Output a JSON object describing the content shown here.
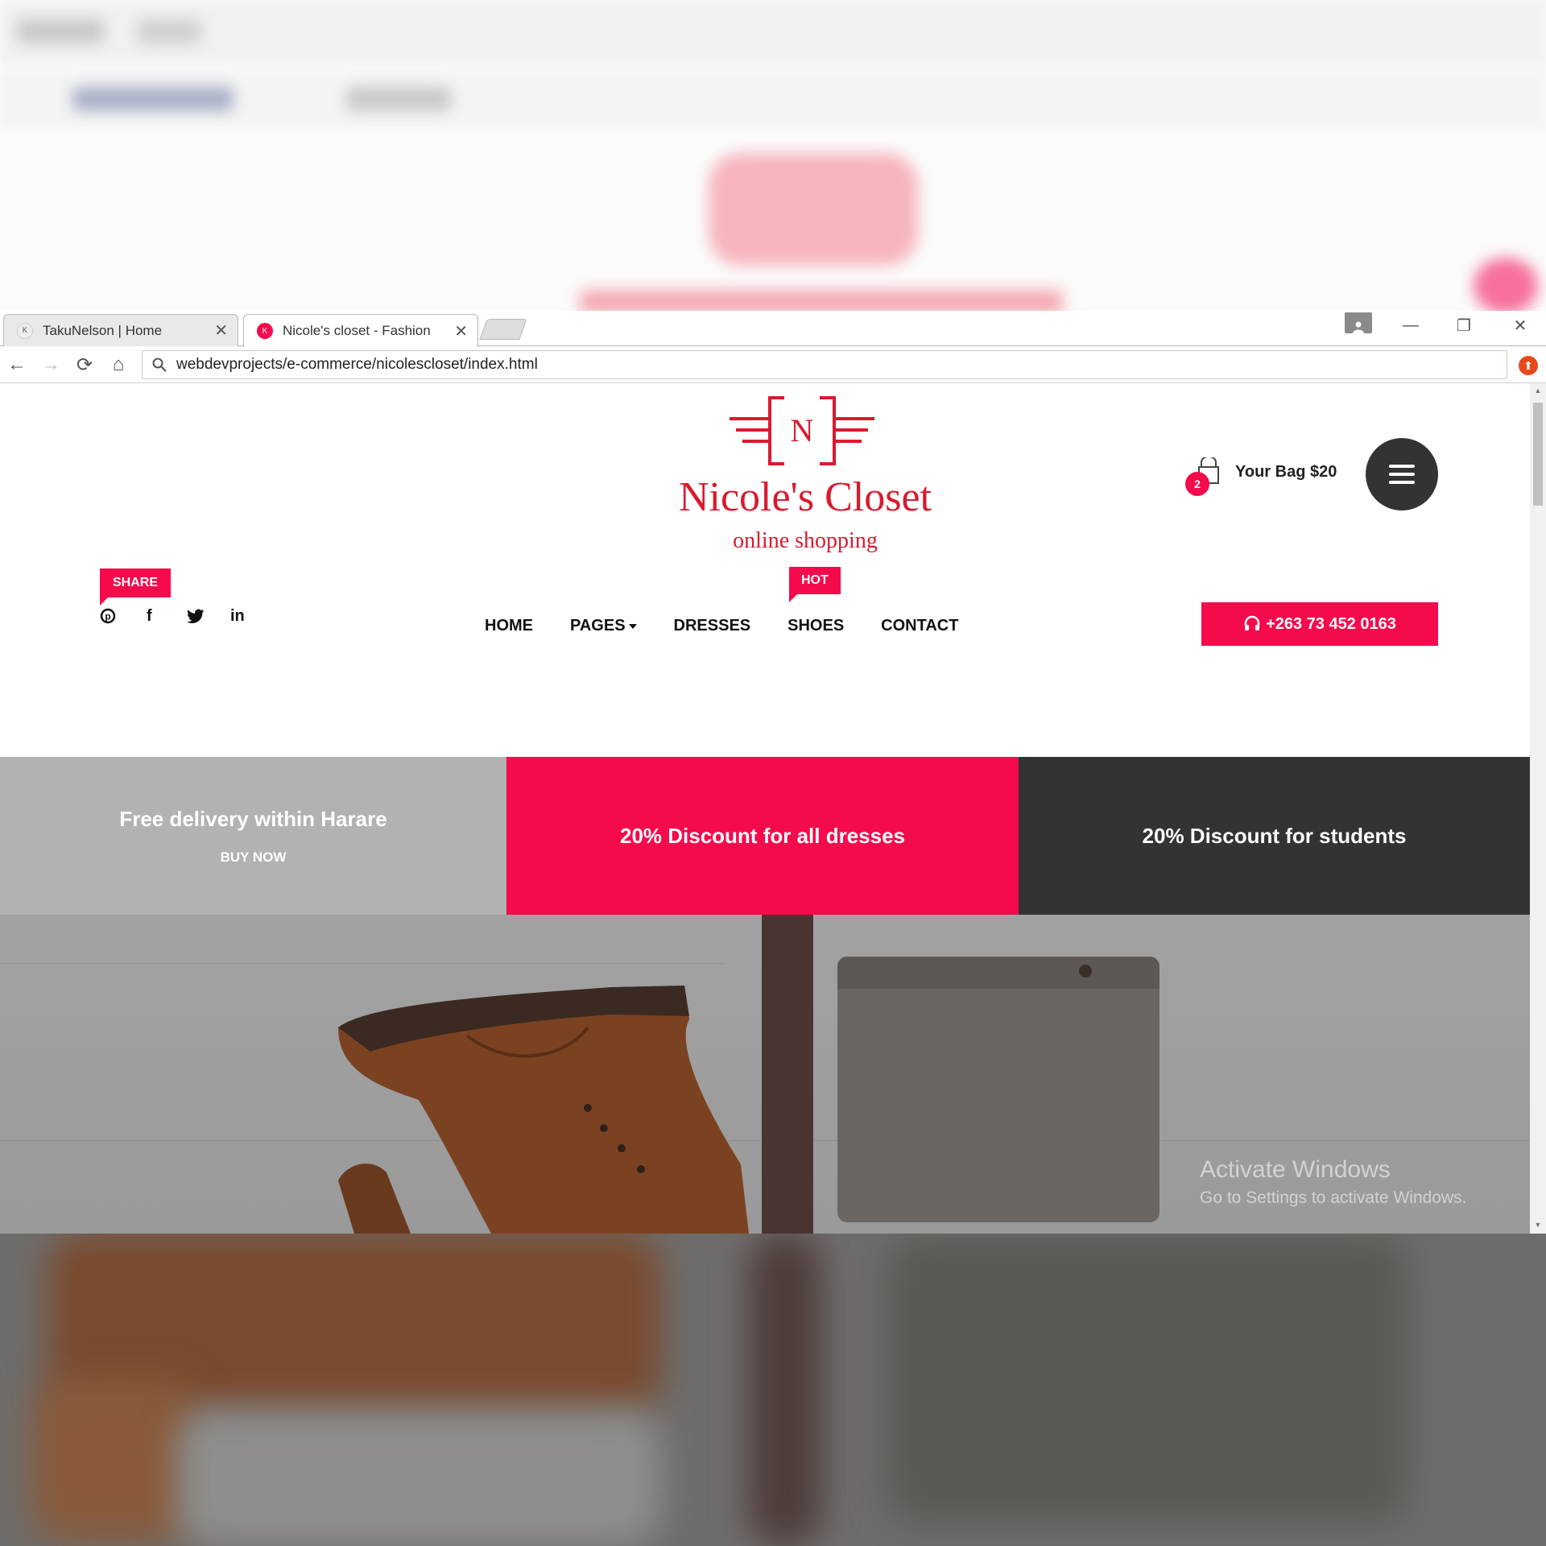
{
  "browser": {
    "tabs": [
      {
        "title": "TakuNelson | Home",
        "favicon": "K",
        "active": false
      },
      {
        "title": "Nicole's closet - Fashion",
        "favicon": "K",
        "active": true
      }
    ],
    "url": "webdevprojects/e-commerce/nicolescloset/index.html"
  },
  "header": {
    "logo_letter": "N",
    "brand": "Nicole's Closet",
    "tagline": "online shopping",
    "bag_count": "2",
    "bag_label": "Your Bag $20"
  },
  "share": {
    "label": "SHARE",
    "icons": [
      "pinterest-icon",
      "facebook-icon",
      "twitter-icon",
      "linkedin-icon"
    ],
    "glyphs": [
      "℗",
      "f",
      "🐦",
      "in"
    ]
  },
  "nav": {
    "items": [
      "HOME",
      "PAGES",
      "DRESSES",
      "SHOES",
      "CONTACT"
    ],
    "hot_label": "HOT"
  },
  "phone": "+263 73 452 0163",
  "promos": [
    {
      "title": "Free delivery within Harare",
      "button": "BUY NOW",
      "color": "#b2b2b2"
    },
    {
      "title": "20% Discount for all dresses",
      "color": "#f50a4b"
    },
    {
      "title": "20% Discount for students",
      "color": "#333333"
    }
  ],
  "watermark": {
    "line1": "Activate Windows",
    "line2": "Go to Settings to activate Windows."
  },
  "colors": {
    "accent": "#f50a4b",
    "brand_red": "#d91a2e",
    "dark": "#333333"
  }
}
